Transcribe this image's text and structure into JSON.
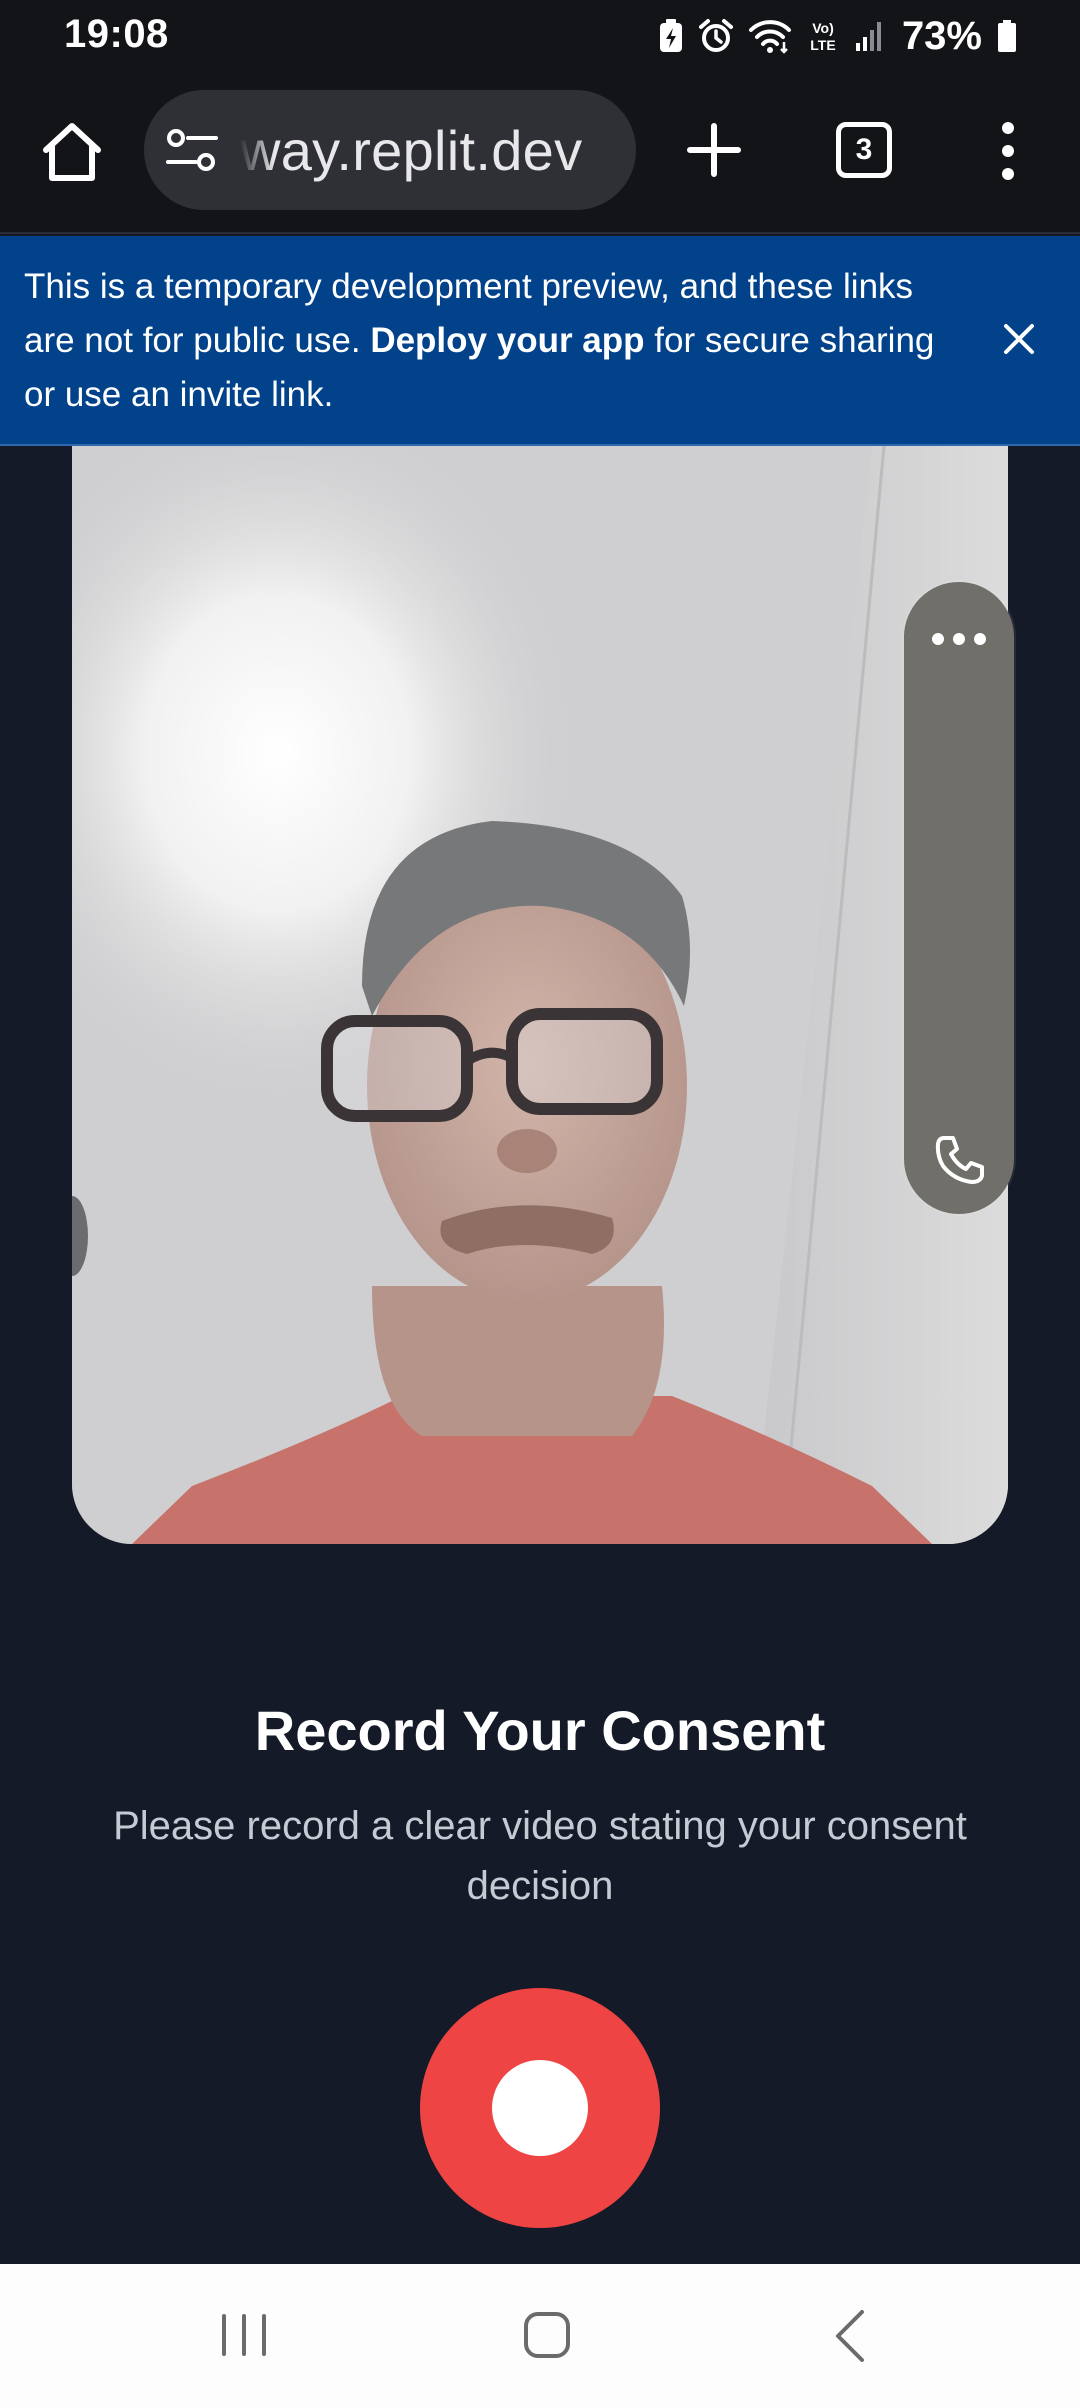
{
  "status_bar": {
    "time": "19:08",
    "battery": "73%",
    "network_label": "Vo) LTE",
    "icons": [
      "battery-saver-icon",
      "alarm-icon",
      "wifi-icon",
      "volte-icon",
      "signal-icon",
      "battery-icon"
    ]
  },
  "browser": {
    "url": "way.replit.dev",
    "tab_count": "3",
    "icons": [
      "home-icon",
      "site-settings-icon",
      "new-tab-icon",
      "tab-switcher-icon",
      "more-menu-icon"
    ]
  },
  "banner": {
    "text_before": "This is a temporary development preview, and these links are not for public use. ",
    "bold_text": "Deploy your app",
    "text_after": " for secure sharing or use an invite link.",
    "close_icon": "close-icon",
    "bg_color": "#01428a"
  },
  "video": {
    "overlay_icons": [
      "more-horizontal-icon",
      "phone-icon"
    ]
  },
  "consent": {
    "title": "Record Your Consent",
    "subtitle": "Please record a clear video stating your consent decision"
  },
  "record_button": {
    "color": "#ee4444"
  },
  "nav_bar": {
    "icons": [
      "recents-icon",
      "home-nav-icon",
      "back-icon"
    ]
  }
}
